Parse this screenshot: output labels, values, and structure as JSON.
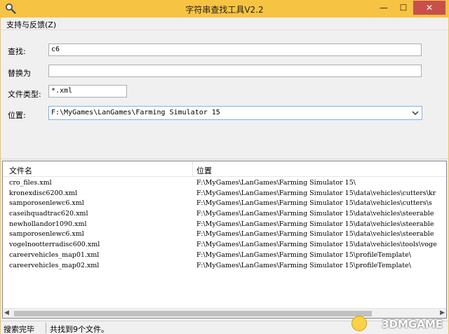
{
  "window": {
    "title": "字符串查找工具V2.2",
    "controls": {
      "minimize": "—",
      "maximize": "☐",
      "close": "✕"
    }
  },
  "menu": {
    "items": [
      "支持与反馈(Z)"
    ]
  },
  "form": {
    "search_label": "查找:",
    "search_value": "c6",
    "replace_label": "替换为",
    "replace_value": "",
    "filetype_label": "文件类型:",
    "filetype_value": "*.xml",
    "location_label": "位置:",
    "location_value": "F:\\MyGames\\LanGames\\Farming Simulator 15"
  },
  "results": {
    "columns": [
      "文件名",
      "位置"
    ],
    "rows": [
      [
        "cro_files.xml",
        "F:\\MyGames\\LanGames\\Farming Simulator 15\\"
      ],
      [
        "kronexdisc6200.xml",
        "F:\\MyGames\\LanGames\\Farming Simulator 15\\data\\vehicles\\cutters\\kr"
      ],
      [
        "samporosenlewc6.xml",
        "F:\\MyGames\\LanGames\\Farming Simulator 15\\data\\vehicles\\cutters\\s"
      ],
      [
        "caseihquadtrac620.xml",
        "F:\\MyGames\\LanGames\\Farming Simulator 15\\data\\vehicles\\steerable"
      ],
      [
        "newhollandor1090.xml",
        "F:\\MyGames\\LanGames\\Farming Simulator 15\\data\\vehicles\\steerable"
      ],
      [
        "samporosenlewc6.xml",
        "F:\\MyGames\\LanGames\\Farming Simulator 15\\data\\vehicles\\steerable"
      ],
      [
        "vogelnootterradisc600.xml",
        "F:\\MyGames\\LanGames\\Farming Simulator 15\\data\\vehicles\\tools\\voge"
      ],
      [
        "careervehicles_map01.xml",
        "F:\\MyGames\\LanGames\\Farming Simulator 15\\profileTemplate\\"
      ],
      [
        "careervehicles_map02.xml",
        "F:\\MyGames\\LanGames\\Farming Simulator 15\\profileTemplate\\"
      ]
    ]
  },
  "status": {
    "state": "搜索完毕",
    "count_text": "共找到9个文件。"
  },
  "watermark": {
    "text": "3DMGAME"
  },
  "icons": {
    "app": "magnifier-icon",
    "combo_arrow": "chevron-down-icon",
    "scroll_left": "arrow-left-icon",
    "scroll_right": "arrow-right-icon"
  },
  "colors": {
    "titlebar": "#f7c342",
    "close": "#c7504b"
  }
}
